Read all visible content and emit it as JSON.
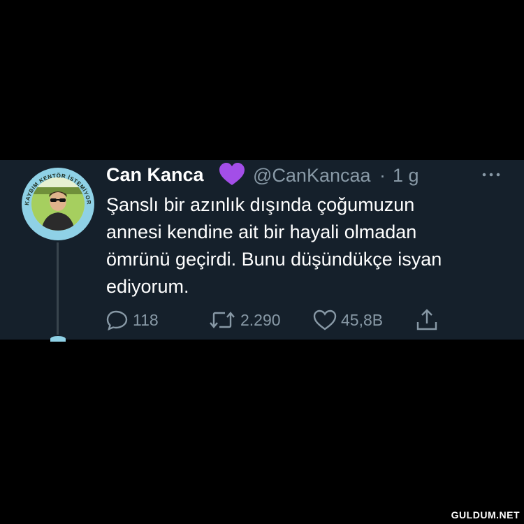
{
  "tweet": {
    "display_name": "Can Kanca",
    "name_emoji": "purple-heart-icon",
    "handle": "@CanKancaa",
    "separator": "·",
    "time": "1 g",
    "text_lines": [
      "Şanslı bir azınlık dışında çoğumuzun",
      "annesi kendine ait bir hayali olmadan",
      "ömrünü geçirdi. Bunu düşündükçe isyan",
      "ediyorum."
    ],
    "actions": {
      "replies": "118",
      "retweets": "2.290",
      "likes": "45,8B"
    },
    "avatar_ring_text": "KAYBIM KENTÖR İSTEMİYORUZ"
  },
  "watermark": "GULDUM.NET",
  "colors": {
    "background": "#000000",
    "card": "#15202b",
    "secondary_text": "#8899a6",
    "emoji_purple": "#a34ee8",
    "avatar_ring": "#8fd1e6"
  }
}
